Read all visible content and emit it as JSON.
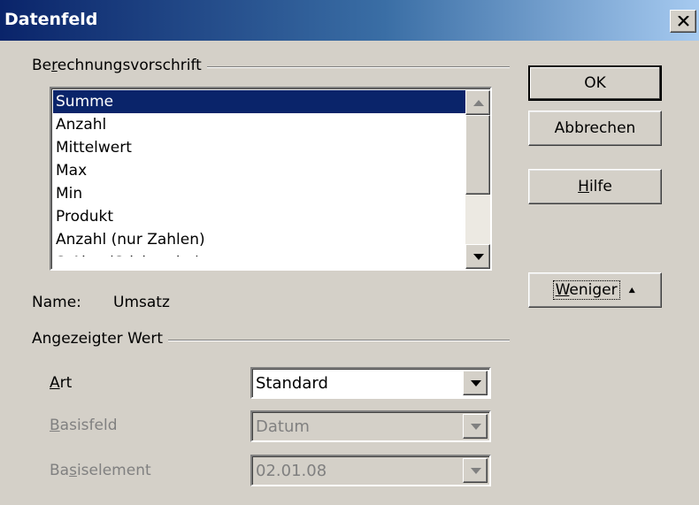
{
  "window": {
    "title": "Datenfeld"
  },
  "calc": {
    "group_label_pre": "Be",
    "group_label_key": "r",
    "group_label_post": "echnungsvorschrift",
    "items": [
      "Summe",
      "Anzahl",
      "Mittelwert",
      "Max",
      "Min",
      "Produkt",
      "Anzahl (nur Zahlen)",
      "StAbw (Stichprobe)"
    ],
    "selected": "Summe"
  },
  "name": {
    "label": "Name:",
    "value": "Umsatz"
  },
  "display": {
    "group_label": "Angezeigter Wert",
    "type": {
      "label_key": "A",
      "label_rest": "rt",
      "value": "Standard"
    },
    "base_field": {
      "label_key": "B",
      "label_rest": "asisfeld",
      "value": "Datum"
    },
    "base_item": {
      "label_pre": "Ba",
      "label_key": "s",
      "label_post": "iselement",
      "value": "02.01.08"
    }
  },
  "buttons": {
    "ok": "OK",
    "cancel": "Abbrechen",
    "help_key": "H",
    "help_rest": "ilfe",
    "less_key": "W",
    "less_rest": "eniger",
    "less_arrow": "⯅"
  }
}
